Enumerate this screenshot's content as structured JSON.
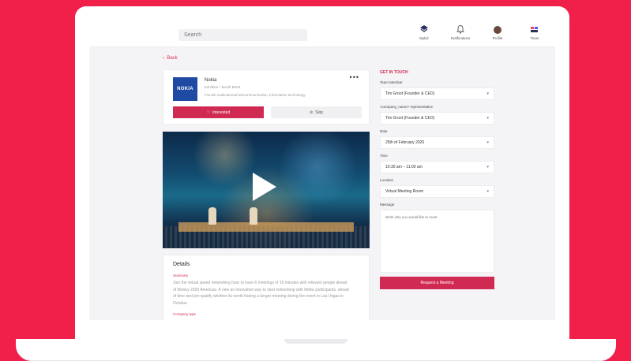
{
  "topbar": {
    "search_placeholder": "Search",
    "nav": [
      {
        "label": "Mybiz",
        "icon": "mybiz-icon"
      },
      {
        "label": "Notifications",
        "icon": "bell-icon"
      },
      {
        "label": "Profile",
        "icon": "avatar"
      },
      {
        "label": "Team",
        "icon": "team-icon"
      }
    ]
  },
  "back_label": "Back",
  "company": {
    "logo_text": "NOKIA",
    "name": "Nokia",
    "meta": "Exhibitor  •  Booth B305",
    "description": "Finnish multinational telecommunication, information technology",
    "more": "•••",
    "interested_label": "Interested",
    "skip_label": "Skip"
  },
  "details": {
    "title": "Details",
    "summary_label": "Summary",
    "summary_text": "Join the virtual speed networking hour to have 6 meetings of 10 minutes with relevant people ahead of Money 2020 Americas. A new an innovative way to start networking with fellow participants, ahead of time and pre-qualify whether its worth having a longer meeting during the event in Las Vegas in October.",
    "type_label": "Company type"
  },
  "get_in_touch": {
    "title": "GET IN TOUCH",
    "fields": [
      {
        "label": "Team Member",
        "value": "Tim Groot (Founder & CEO)"
      },
      {
        "label": "<company_name> representative",
        "value": "Tim Groot (Founder & CEO)"
      },
      {
        "label": "Date",
        "value": "25th of February 2020"
      },
      {
        "label": "Time",
        "value": "10:30 am – 11:00 am"
      },
      {
        "label": "Location",
        "value": "Virtual Meeting Room"
      }
    ],
    "message_label": "Message",
    "message_placeholder": "Write why you would like to meet",
    "request_label": "Request a Meeting"
  }
}
